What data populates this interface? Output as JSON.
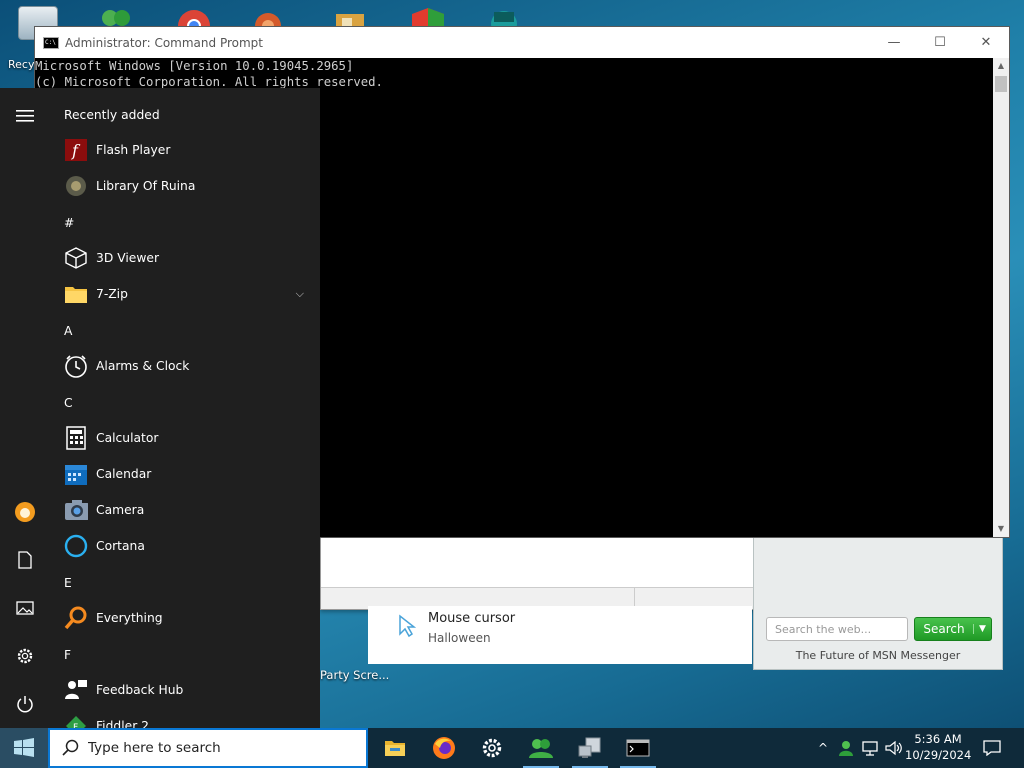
{
  "desktop": {
    "recycle_label": "Recy",
    "party_label": "Party Scre...",
    "cursor_item": {
      "title": "Mouse cursor",
      "subtitle": "Halloween"
    },
    "msn": {
      "search_placeholder": "Search the web...",
      "search_button": "Search",
      "footer": "The Future of MSN Messenger"
    }
  },
  "cmd": {
    "title": "Administrator: Command Prompt",
    "icon_text": "C:\\",
    "lines": [
      "Microsoft Windows [Version 10.0.19045.2965]",
      "(c) Microsoft Corporation. All rights reserved."
    ],
    "controls": {
      "minimize": "—",
      "maximize": "☐",
      "close": "✕"
    }
  },
  "start_menu": {
    "recently_added": "Recently added",
    "items": [
      {
        "label": "Flash Player",
        "icon": "flash-player-icon"
      },
      {
        "label": "Library Of Ruina",
        "icon": "library-of-ruina-icon"
      },
      {
        "label": "#",
        "header": true
      },
      {
        "label": "3D Viewer",
        "icon": "3d-viewer-icon"
      },
      {
        "label": "7-Zip",
        "icon": "folder-icon",
        "expandable": true
      },
      {
        "label": "A",
        "header": true
      },
      {
        "label": "Alarms & Clock",
        "icon": "clock-icon"
      },
      {
        "label": "C",
        "header": true
      },
      {
        "label": "Calculator",
        "icon": "calculator-icon"
      },
      {
        "label": "Calendar",
        "icon": "calendar-icon"
      },
      {
        "label": "Camera",
        "icon": "camera-icon"
      },
      {
        "label": "Cortana",
        "icon": "cortana-icon"
      },
      {
        "label": "E",
        "header": true
      },
      {
        "label": "Everything",
        "icon": "search-magnifier-icon"
      },
      {
        "label": "F",
        "header": true
      },
      {
        "label": "Feedback Hub",
        "icon": "feedback-hub-icon"
      },
      {
        "label": "Fiddler 2",
        "icon": "fiddler-icon"
      }
    ]
  },
  "taskbar": {
    "search_placeholder": "Type here to search",
    "clock_time": "5:36 AM",
    "clock_date": "10/29/2024",
    "apps": [
      "file-explorer-icon",
      "firefox-icon",
      "settings-icon",
      "messenger-icon",
      "network-computer-icon",
      "command-prompt-icon"
    ],
    "tray_chevron": "^"
  }
}
